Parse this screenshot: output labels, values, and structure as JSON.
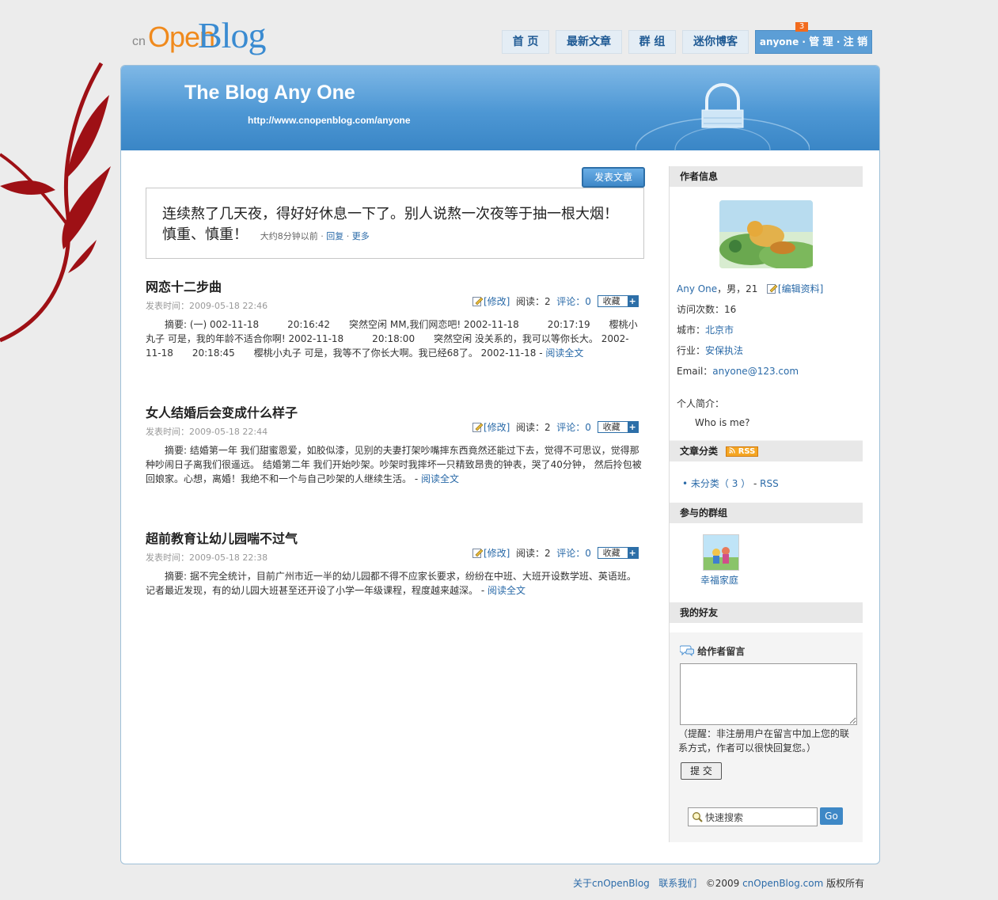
{
  "header": {
    "logo_prefix": "cn",
    "logo_open": "Open",
    "logo_blog": "Blog",
    "nav": [
      {
        "label": "首 页"
      },
      {
        "label": "最新文章"
      },
      {
        "label": "群 组"
      },
      {
        "label": "迷你博客"
      }
    ],
    "user_menu": {
      "username": "anyone",
      "manage": "管 理",
      "logout": "注 销",
      "badge": "3"
    }
  },
  "banner": {
    "title": "The Blog Any One",
    "url": "http://www.cnopenblog.com/anyone"
  },
  "main": {
    "post_button": "发表文章",
    "status": {
      "text": "连续熬了几天夜，得好好休息一下了。别人说熬一次夜等于抽一根大烟！慎重、慎重！",
      "time": "大约8分钟以前",
      "reply": "回复",
      "more": "更多"
    },
    "posts": [
      {
        "title": "网恋十二步曲",
        "date": "发表时间：2009-05-18 22:46",
        "edit": "[修改]",
        "reads": "阅读：2",
        "comments": "评论：0",
        "fav": "收藏",
        "summary": "摘要: (一) 002-11-18　　　20:16:42　　突然空闲 MM,我们网恋吧! 2002-11-18　　　20:17:19　　樱桃小丸子 可是，我的年龄不适合你啊! 2002-11-18　　　20:18:00　　突然空闲 没关系的，我可以等你长大。 2002-11-18　　20:18:45　　樱桃小丸子 可是，我等不了你长大啊。我已经68了。 2002-11-18 ",
        "read_more": "阅读全文"
      },
      {
        "title": "女人结婚后会变成什么样子",
        "date": "发表时间：2009-05-18 22:44",
        "edit": "[修改]",
        "reads": "阅读：2",
        "comments": "评论：0",
        "fav": "收藏",
        "summary": "摘要: 结婚第一年 我们甜蜜恩爱，如胶似漆，见别的夫妻打架吵嘴摔东西竟然还能过下去，觉得不可思议，觉得那种吵闹日子离我们很遥远。 结婚第二年 我们开始吵架。吵架时我摔坏一只精致昂贵的钟表，哭了40分钟， 然后拎包被回娘家。心想，离婚！我绝不和一个与自己吵架的人继续生活。 ",
        "read_more": "阅读全文"
      },
      {
        "title": "超前教育让幼儿园喘不过气",
        "date": "发表时间：2009-05-18 22:38",
        "edit": "[修改]",
        "reads": "阅读：2",
        "comments": "评论：0",
        "fav": "收藏",
        "summary": "摘要: 据不完全统计，目前广州市近一半的幼儿园都不得不应家长要求，纷纷在中班、大班开设数学班、英语班。记者最近发现，有的幼儿园大班甚至还开设了小学一年级课程，程度越来越深。 ",
        "read_more": "阅读全文"
      }
    ]
  },
  "sidebar": {
    "author_title": "作者信息",
    "author_name": "Any One",
    "author_info": "，男，21",
    "edit_profile": "[编辑资料]",
    "visits": "访问次数：16",
    "city_label": "城市：",
    "city": "北京市",
    "industry_label": "行业：",
    "industry": "安保执法",
    "email_label": "Email：",
    "email": "anyone@123.com",
    "bio_label": "个人简介：",
    "bio": "Who is me?",
    "categories_title": "文章分类",
    "rss_badge": "RSS",
    "category_item": "未分类（ 3 ）",
    "category_rss": "RSS",
    "groups_title": "参与的群组",
    "group_name": "幸福家庭",
    "friends_title": "我的好友",
    "message_title": "给作者留言",
    "message_hint": "（提醒：非注册用户在留言中加上您的联系方式，作者可以很快回复您。）",
    "submit": "提 交",
    "search_placeholder": "快速搜索",
    "go": "Go"
  },
  "footer": {
    "about": "关于cnOpenBlog",
    "contact": "联系我们",
    "copyright_prefix": "©2009 ",
    "site": "cnOpenBlog.com",
    "rights": " 版权所有"
  },
  "colors": {
    "accent": "#2a6aa8",
    "banner": "#4d97d4",
    "badge": "#f26b1d"
  }
}
